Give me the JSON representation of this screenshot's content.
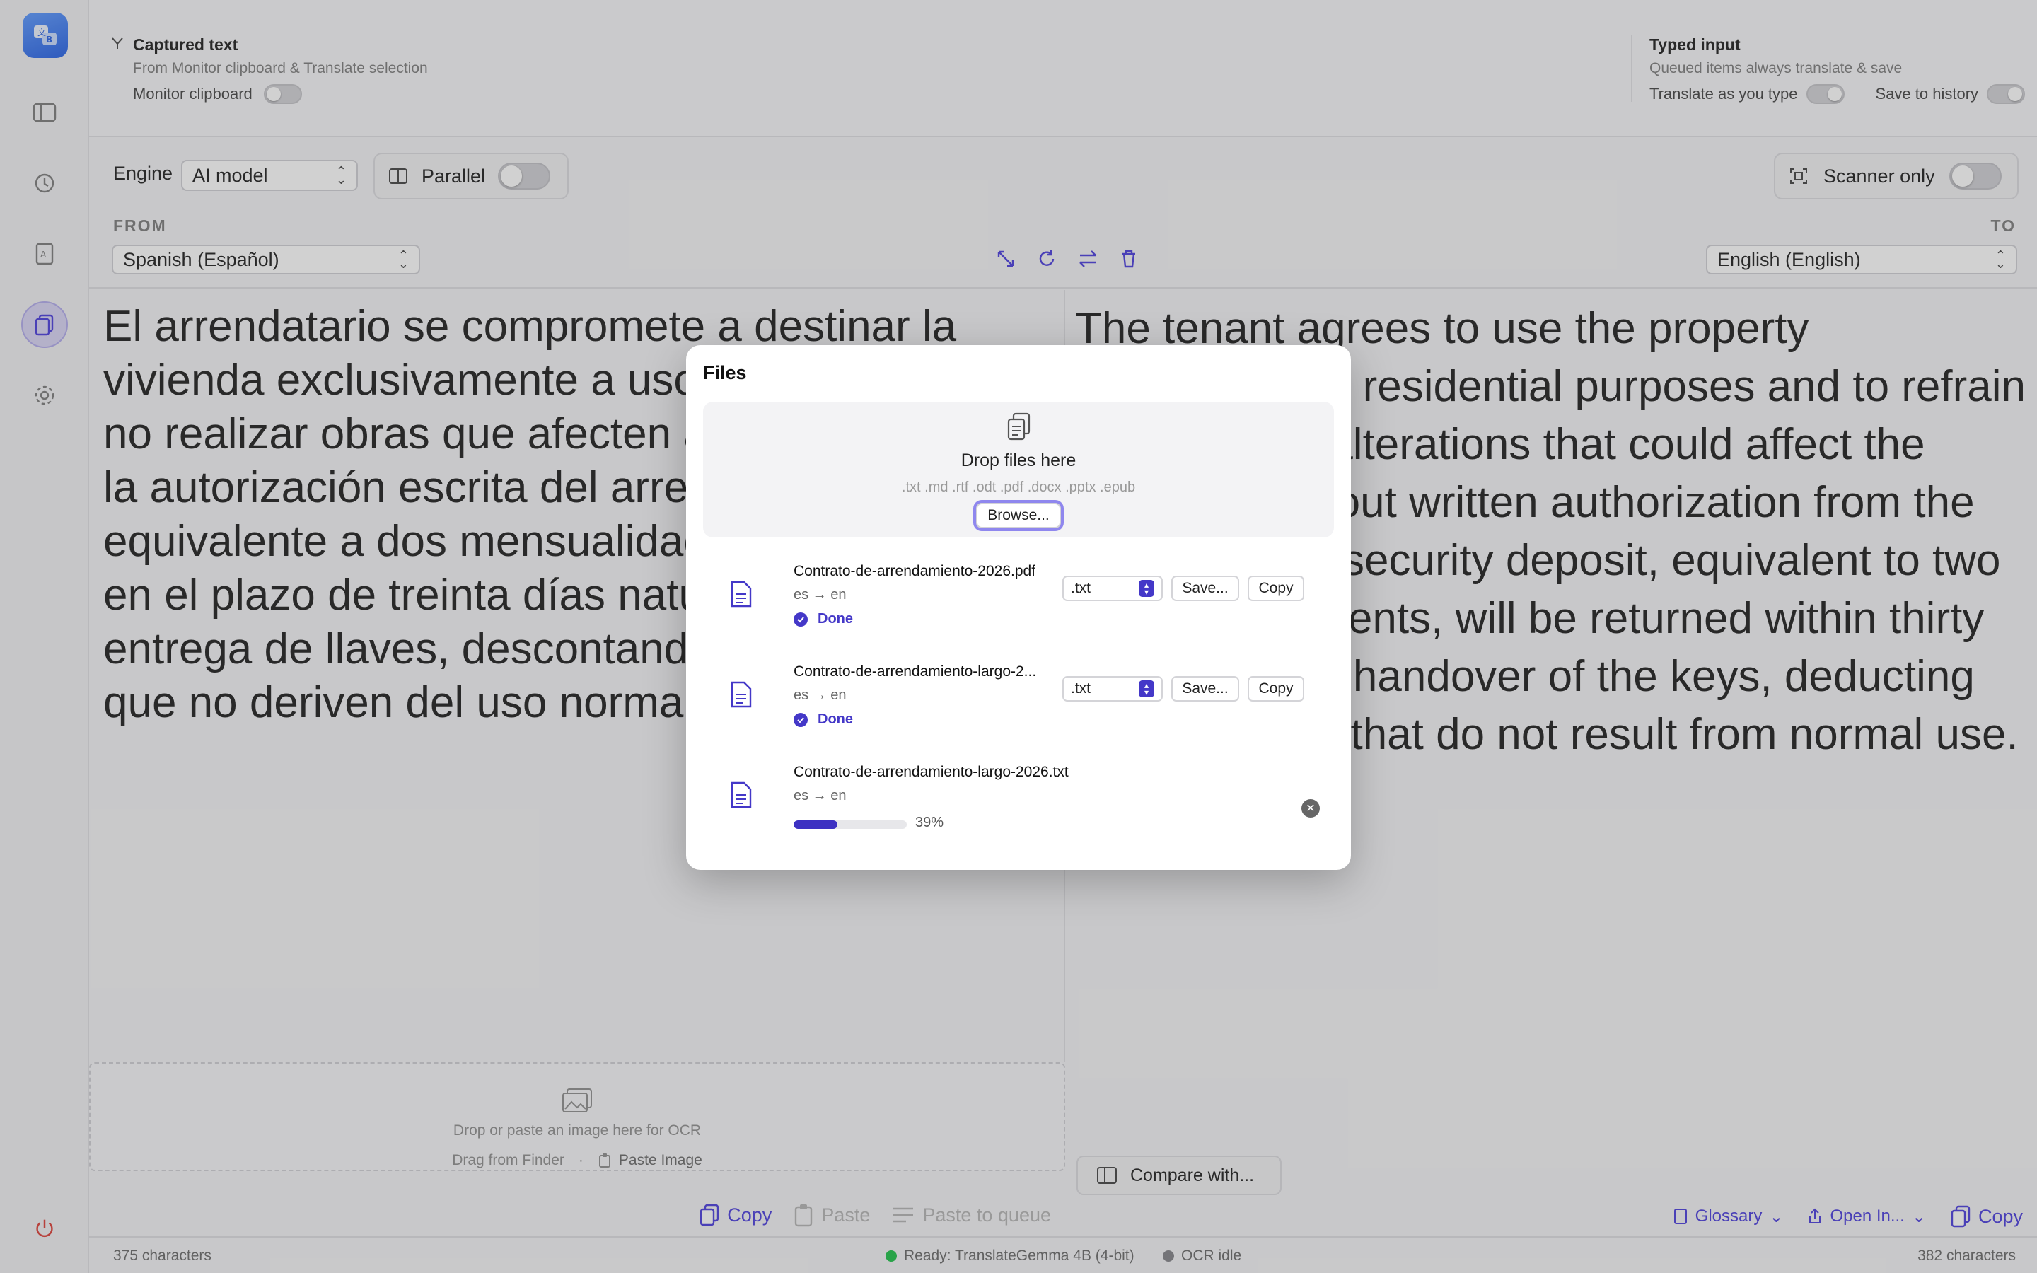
{
  "colors": {
    "accent": "#4438c8",
    "accent_light": "#5b4fe0",
    "ready": "#33c759",
    "idle": "#8e8e93"
  },
  "capture": {
    "title": "Captured text",
    "subtitle": "From Monitor clipboard & Translate selection",
    "monitor_label": "Monitor clipboard",
    "typed_title": "Typed input",
    "typed_subtitle": "Queued items always translate & save",
    "translate_as_you_type": "Translate as you type",
    "save_to_history": "Save to history"
  },
  "engine": {
    "label": "Engine",
    "value": "AI model",
    "parallel_label": "Parallel",
    "scanner_label": "Scanner only"
  },
  "languages": {
    "from_label": "FROM",
    "to_label": "TO",
    "source": "Spanish (Español)",
    "target": "English (English)"
  },
  "source_text": "El arrendatario se compromete a destinar la vivienda exclusivamente a uso residencial y a no realizar obras que afecten a la estructura sin la autorización escrita del arrendador. La fianza, equivalente a dos mensualidades, se devolverá en el plazo de treinta días naturales tras la entrega de llaves, descontando los desperfectos que no deriven del uso normal.",
  "target_text": "The tenant agrees to use the property exclusively for residential purposes and to refrain from making alterations that could affect the structure without written authorization from the landlord. The security deposit, equivalent to two monthly payments, will be returned within thirty days after the handover of the keys, deducting any damages that do not result from normal use.",
  "ocr": {
    "drop_text": "Drop or paste an image here for OCR",
    "drag_text": "Drag from Finder",
    "separator": "·",
    "paste_image": "Paste Image"
  },
  "source_actions": {
    "copy": "Copy",
    "paste": "Paste",
    "paste_queue": "Paste to queue"
  },
  "target_actions": {
    "compare": "Compare with...",
    "glossary": "Glossary",
    "open_in": "Open In...",
    "copy": "Copy"
  },
  "status": {
    "left_chars": "375 characters",
    "ready": "Ready: TranslateGemma 4B (4-bit)",
    "ocr": "OCR idle",
    "right_chars": "382 characters"
  },
  "files_modal": {
    "title": "Files",
    "drop_title": "Drop files here",
    "extensions": ".txt .md .rtf .odt .pdf .docx .pptx .epub",
    "browse": "Browse...",
    "save_label": "Save...",
    "copy_label": "Copy",
    "files": [
      {
        "name": "Contrato-de-arrendamiento-2026.pdf",
        "lang": "es → en",
        "status": "Done",
        "format": ".txt"
      },
      {
        "name": "Contrato-de-arrendamiento-largo-2...",
        "lang": "es → en",
        "status": "Done",
        "format": ".txt"
      },
      {
        "name": "Contrato-de-arrendamiento-largo-2026.txt",
        "lang": "es → en",
        "progress": 0.39,
        "progress_label": "39%"
      }
    ]
  }
}
